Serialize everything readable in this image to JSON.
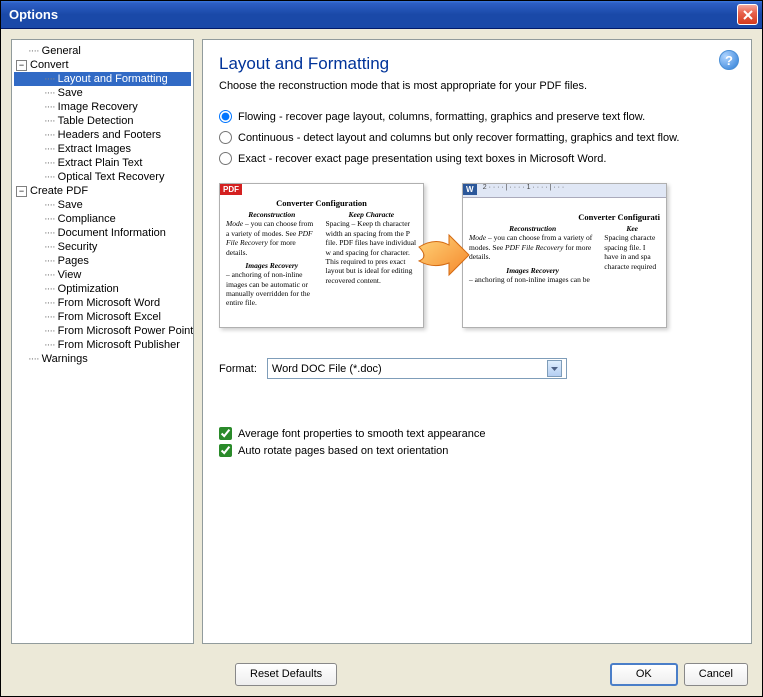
{
  "window": {
    "title": "Options"
  },
  "tree": {
    "general": "General",
    "convert": "Convert",
    "convert_children": {
      "layout": "Layout and Formatting",
      "save": "Save",
      "image_recovery": "Image Recovery",
      "table_detection": "Table Detection",
      "headers_footers": "Headers and Footers",
      "extract_images": "Extract Images",
      "extract_plain_text": "Extract Plain Text",
      "optical": "Optical Text Recovery"
    },
    "create_pdf": "Create PDF",
    "create_children": {
      "save": "Save",
      "compliance": "Compliance",
      "doc_info": "Document Information",
      "security": "Security",
      "pages": "Pages",
      "view": "View",
      "optimization": "Optimization",
      "from_word": "From Microsoft Word",
      "from_excel": "From Microsoft Excel",
      "from_ppt": "From Microsoft Power Point",
      "from_publisher": "From Microsoft Publisher"
    },
    "warnings": "Warnings"
  },
  "page": {
    "title": "Layout and Formatting",
    "desc": "Choose the reconstruction mode that is most appropriate for your PDF files."
  },
  "radios": {
    "flowing": "Flowing - recover page layout, columns, formatting, graphics and preserve text flow.",
    "continuous": "Continuous - detect layout and columns but only recover formatting, graphics and text flow.",
    "exact": "Exact - recover exact page presentation using text boxes in Microsoft Word.",
    "selected": "flowing"
  },
  "preview": {
    "pdf_badge": "PDF",
    "word_badge": "W",
    "ruler": "2 · · · · | · · · · 1 · · · · | · · ·",
    "title": "Converter Configuration",
    "title_right": "Converter Configurati",
    "col1_hd": "Reconstruction",
    "col1_txt": "Mode – you can choose from a variety of modes. See PDF File Recovery for more details.",
    "col1b_hd": "Images Recovery",
    "col1b_txt": "– anchoring of non-inline images can be automatic or manually overridden for the entire file.",
    "col2_hd": "Keep Characte",
    "col2_txt": "Spacing – Keep th character width an spacing from the P file.  PDF files have individual w and spacing for character.  This required to pres exact layout but is ideal for editing recovered content.",
    "r_col1_hd": "Reconstruction",
    "r_col1_txt": "Mode – you can choose from a variety of modes. See PDF File Recovery for more details.",
    "r_col1b_hd": "Images Recovery",
    "r_col1b_txt": "– anchoring of non-inline images can be",
    "r_col2_hd": "Kee",
    "r_col2_txt": "Spacing characte spacing file.  I have in and spa characte required"
  },
  "format": {
    "label": "Format:",
    "value": "Word DOC File (*.doc)"
  },
  "checks": {
    "avg_font": "Average font properties to smooth text appearance",
    "auto_rotate": "Auto rotate pages based on text orientation"
  },
  "buttons": {
    "reset": "Reset Defaults",
    "ok": "OK",
    "cancel": "Cancel"
  }
}
